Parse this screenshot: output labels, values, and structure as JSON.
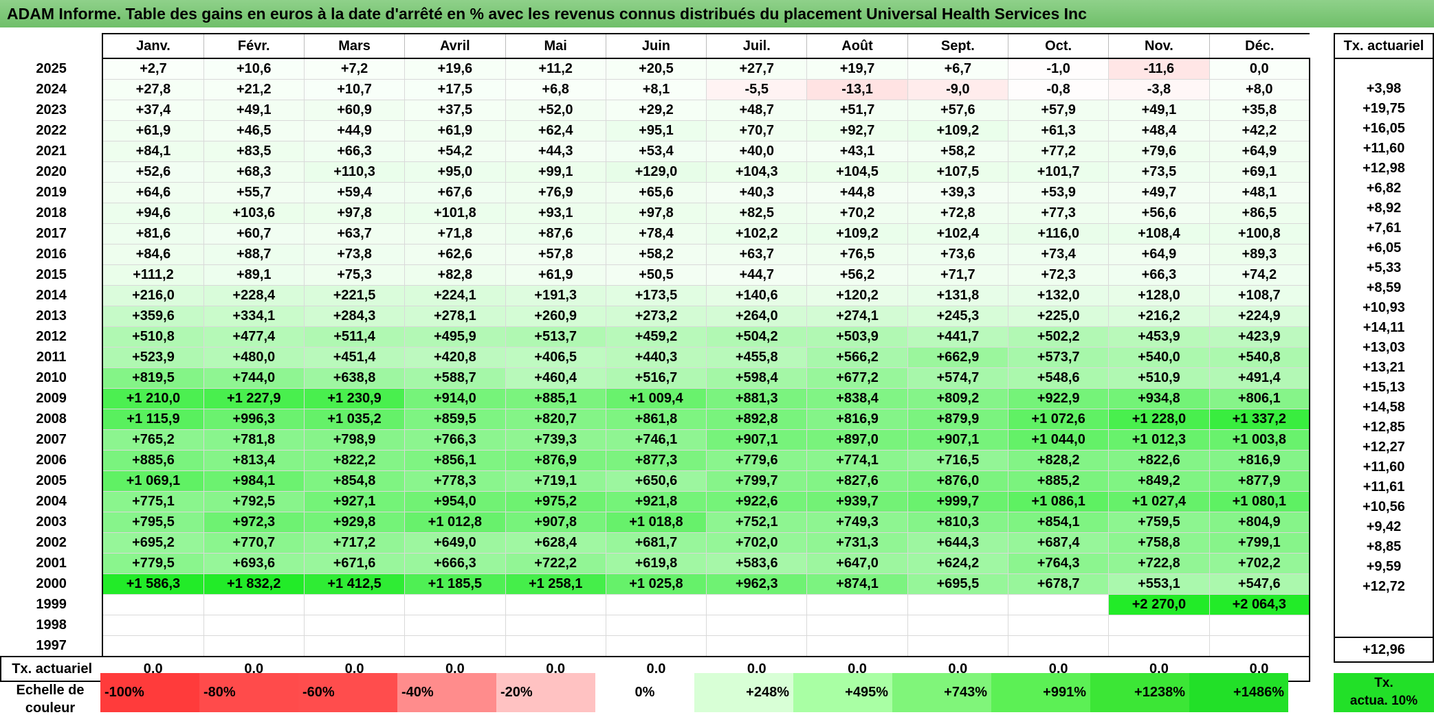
{
  "title": "ADAM Informe. Table des gains en euros à la date d'arrêté en % avec les revenus connus distribués du placement Universal Health Services Inc",
  "colors": {
    "title_bg": "#7cc777",
    "max_green": "#22e028",
    "max_red": "#ff3b3b"
  },
  "chart_data": {
    "type": "table",
    "months": [
      "Janv.",
      "Févr.",
      "Mars",
      "Avril",
      "Mai",
      "Juin",
      "Juil.",
      "Août",
      "Sept.",
      "Oct.",
      "Nov.",
      "Déc."
    ],
    "side_header": "Tx. actuariel",
    "rows": [
      {
        "year": "2025",
        "values": [
          "+2,7",
          "+10,6",
          "+7,2",
          "+19,6",
          "+11,2",
          "+20,5",
          "+27,7",
          "+19,7",
          "+6,7",
          "-1,0",
          "-11,6",
          "0,0"
        ],
        "tx": ""
      },
      {
        "year": "2024",
        "values": [
          "+27,8",
          "+21,2",
          "+10,7",
          "+17,5",
          "+6,8",
          "+8,1",
          "-5,5",
          "-13,1",
          "-9,0",
          "-0,8",
          "-3,8",
          "+8,0"
        ],
        "tx": "+3,98"
      },
      {
        "year": "2023",
        "values": [
          "+37,4",
          "+49,1",
          "+60,9",
          "+37,5",
          "+52,0",
          "+29,2",
          "+48,7",
          "+51,7",
          "+57,6",
          "+57,9",
          "+49,1",
          "+35,8"
        ],
        "tx": "+19,75"
      },
      {
        "year": "2022",
        "values": [
          "+61,9",
          "+46,5",
          "+44,9",
          "+61,9",
          "+62,4",
          "+95,1",
          "+70,7",
          "+92,7",
          "+109,2",
          "+61,3",
          "+48,4",
          "+42,2"
        ],
        "tx": "+16,05"
      },
      {
        "year": "2021",
        "values": [
          "+84,1",
          "+83,5",
          "+66,3",
          "+54,2",
          "+44,3",
          "+53,4",
          "+40,0",
          "+43,1",
          "+58,2",
          "+77,2",
          "+79,6",
          "+64,9"
        ],
        "tx": "+11,60"
      },
      {
        "year": "2020",
        "values": [
          "+52,6",
          "+68,3",
          "+110,3",
          "+95,0",
          "+99,1",
          "+129,0",
          "+104,3",
          "+104,5",
          "+107,5",
          "+101,7",
          "+73,5",
          "+69,1"
        ],
        "tx": "+12,98"
      },
      {
        "year": "2019",
        "values": [
          "+64,6",
          "+55,7",
          "+59,4",
          "+67,6",
          "+76,9",
          "+65,6",
          "+40,3",
          "+44,8",
          "+39,3",
          "+53,9",
          "+49,7",
          "+48,1"
        ],
        "tx": "+6,82"
      },
      {
        "year": "2018",
        "values": [
          "+94,6",
          "+103,6",
          "+97,8",
          "+101,8",
          "+93,1",
          "+97,8",
          "+82,5",
          "+70,2",
          "+72,8",
          "+77,3",
          "+56,6",
          "+86,5"
        ],
        "tx": "+8,92"
      },
      {
        "year": "2017",
        "values": [
          "+81,6",
          "+60,7",
          "+63,7",
          "+71,8",
          "+87,6",
          "+78,4",
          "+102,2",
          "+109,2",
          "+102,4",
          "+116,0",
          "+108,4",
          "+100,8"
        ],
        "tx": "+7,61"
      },
      {
        "year": "2016",
        "values": [
          "+84,6",
          "+88,7",
          "+73,8",
          "+62,6",
          "+57,8",
          "+58,2",
          "+63,7",
          "+76,5",
          "+73,6",
          "+73,4",
          "+64,9",
          "+89,3"
        ],
        "tx": "+6,05"
      },
      {
        "year": "2015",
        "values": [
          "+111,2",
          "+89,1",
          "+75,3",
          "+82,8",
          "+61,9",
          "+50,5",
          "+44,7",
          "+56,2",
          "+71,7",
          "+72,3",
          "+66,3",
          "+74,2"
        ],
        "tx": "+5,33"
      },
      {
        "year": "2014",
        "values": [
          "+216,0",
          "+228,4",
          "+221,5",
          "+224,1",
          "+191,3",
          "+173,5",
          "+140,6",
          "+120,2",
          "+131,8",
          "+132,0",
          "+128,0",
          "+108,7"
        ],
        "tx": "+8,59"
      },
      {
        "year": "2013",
        "values": [
          "+359,6",
          "+334,1",
          "+284,3",
          "+278,1",
          "+260,9",
          "+273,2",
          "+264,0",
          "+274,1",
          "+245,3",
          "+225,0",
          "+216,2",
          "+224,9"
        ],
        "tx": "+10,93"
      },
      {
        "year": "2012",
        "values": [
          "+510,8",
          "+477,4",
          "+511,4",
          "+495,9",
          "+513,7",
          "+459,2",
          "+504,2",
          "+503,9",
          "+441,7",
          "+502,2",
          "+453,9",
          "+423,9"
        ],
        "tx": "+14,11"
      },
      {
        "year": "2011",
        "values": [
          "+523,9",
          "+480,0",
          "+451,4",
          "+420,8",
          "+406,5",
          "+440,3",
          "+455,8",
          "+566,2",
          "+662,9",
          "+573,7",
          "+540,0",
          "+540,8"
        ],
        "tx": "+13,03"
      },
      {
        "year": "2010",
        "values": [
          "+819,5",
          "+744,0",
          "+638,8",
          "+588,7",
          "+460,4",
          "+516,7",
          "+598,4",
          "+677,2",
          "+574,7",
          "+548,6",
          "+510,9",
          "+491,4"
        ],
        "tx": "+13,21"
      },
      {
        "year": "2009",
        "values": [
          "+1 210,0",
          "+1 227,9",
          "+1 230,9",
          "+914,0",
          "+885,1",
          "+1 009,4",
          "+881,3",
          "+838,4",
          "+809,2",
          "+922,9",
          "+934,8",
          "+806,1"
        ],
        "tx": "+15,13"
      },
      {
        "year": "2008",
        "values": [
          "+1 115,9",
          "+996,3",
          "+1 035,2",
          "+859,5",
          "+820,7",
          "+861,8",
          "+892,8",
          "+816,9",
          "+879,9",
          "+1 072,6",
          "+1 228,0",
          "+1 337,2"
        ],
        "tx": "+14,58"
      },
      {
        "year": "2007",
        "values": [
          "+765,2",
          "+781,8",
          "+798,9",
          "+766,3",
          "+739,3",
          "+746,1",
          "+907,1",
          "+897,0",
          "+907,1",
          "+1 044,0",
          "+1 012,3",
          "+1 003,8"
        ],
        "tx": "+12,85"
      },
      {
        "year": "2006",
        "values": [
          "+885,6",
          "+813,4",
          "+822,2",
          "+856,1",
          "+876,9",
          "+877,3",
          "+779,6",
          "+774,1",
          "+716,5",
          "+828,2",
          "+822,6",
          "+816,9"
        ],
        "tx": "+12,27"
      },
      {
        "year": "2005",
        "values": [
          "+1 069,1",
          "+984,1",
          "+854,8",
          "+778,3",
          "+719,1",
          "+650,6",
          "+799,7",
          "+827,6",
          "+876,0",
          "+885,2",
          "+849,2",
          "+877,9"
        ],
        "tx": "+11,60"
      },
      {
        "year": "2004",
        "values": [
          "+775,1",
          "+792,5",
          "+927,1",
          "+954,0",
          "+975,2",
          "+921,8",
          "+922,6",
          "+939,7",
          "+999,7",
          "+1 086,1",
          "+1 027,4",
          "+1 080,1"
        ],
        "tx": "+11,61"
      },
      {
        "year": "2003",
        "values": [
          "+795,5",
          "+972,3",
          "+929,8",
          "+1 012,8",
          "+907,8",
          "+1 018,8",
          "+752,1",
          "+749,3",
          "+810,3",
          "+854,1",
          "+759,5",
          "+804,9"
        ],
        "tx": "+10,56"
      },
      {
        "year": "2002",
        "values": [
          "+695,2",
          "+770,7",
          "+717,2",
          "+649,0",
          "+628,4",
          "+681,7",
          "+702,0",
          "+731,3",
          "+644,3",
          "+687,4",
          "+758,8",
          "+799,1"
        ],
        "tx": "+9,42"
      },
      {
        "year": "2001",
        "values": [
          "+779,5",
          "+693,6",
          "+671,6",
          "+666,3",
          "+722,2",
          "+619,8",
          "+583,6",
          "+647,0",
          "+624,2",
          "+764,3",
          "+722,8",
          "+702,2"
        ],
        "tx": "+8,85"
      },
      {
        "year": "2000",
        "values": [
          "+1 586,3",
          "+1 832,2",
          "+1 412,5",
          "+1 185,5",
          "+1 258,1",
          "+1 025,8",
          "+962,3",
          "+874,1",
          "+695,5",
          "+678,7",
          "+553,1",
          "+547,6"
        ],
        "tx": "+9,59"
      },
      {
        "year": "1999",
        "values": [
          "",
          "",
          "",
          "",
          "",
          "",
          "",
          "",
          "",
          "",
          "+2 270,0",
          "+2 064,3"
        ],
        "tx": "+12,72"
      },
      {
        "year": "1998",
        "values": [
          "",
          "",
          "",
          "",
          "",
          "",
          "",
          "",
          "",
          "",
          "",
          ""
        ],
        "tx": ""
      },
      {
        "year": "1997",
        "values": [
          "",
          "",
          "",
          "",
          "",
          "",
          "",
          "",
          "",
          "",
          "",
          ""
        ],
        "tx": ""
      }
    ],
    "summary": {
      "label": "Tx. actuariel",
      "values": [
        "0,0",
        "0,0",
        "0,0",
        "0,0",
        "0,0",
        "0,0",
        "0,0",
        "0,0",
        "0,0",
        "0,0",
        "0,0",
        "0,0"
      ],
      "tx": "+12,96"
    },
    "color_scale": {
      "label_line1": "Echelle de",
      "label_line2": "couleur",
      "steps": [
        {
          "label": "-100%",
          "value": -100,
          "color": "#ff3b3b"
        },
        {
          "label": "-80%",
          "value": -80,
          "color": "#ff4b4b"
        },
        {
          "label": "-60%",
          "value": -60,
          "color": "#ff4d4d"
        },
        {
          "label": "-40%",
          "value": -40,
          "color": "#ff8c8c"
        },
        {
          "label": "-20%",
          "value": -20,
          "color": "#ffc2c2"
        },
        {
          "label": "0%",
          "value": 0,
          "color": "#ffffff"
        },
        {
          "label": "+248%",
          "value": 248,
          "color": "#d8ffd6"
        },
        {
          "label": "+495%",
          "value": 495,
          "color": "#a9ffa4"
        },
        {
          "label": "+743%",
          "value": 743,
          "color": "#80f57a"
        },
        {
          "label": "+991%",
          "value": 991,
          "color": "#5cf055"
        },
        {
          "label": "+1238%",
          "value": 1238,
          "color": "#3ce636"
        },
        {
          "label": "+1486%",
          "value": 1486,
          "color": "#22e028"
        }
      ],
      "tx_label_line1": "Tx.",
      "tx_label_line2": "actua. 10%"
    }
  }
}
